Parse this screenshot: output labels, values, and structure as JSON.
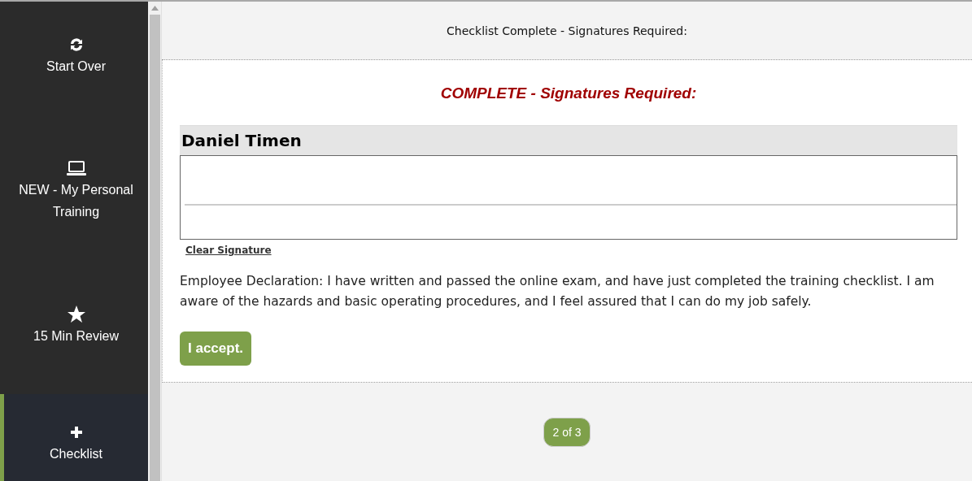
{
  "sidebar": {
    "items": [
      {
        "kind": "refresh",
        "label": "Start Over",
        "selected": false
      },
      {
        "kind": "laptop",
        "label": "NEW - My Personal Training",
        "selected": false
      },
      {
        "kind": "star",
        "label": "15 Min Review",
        "selected": false
      },
      {
        "kind": "plus",
        "label": "Checklist",
        "selected": true
      }
    ]
  },
  "header": {
    "title": "Checklist Complete - Signatures Required:"
  },
  "panel": {
    "status": "COMPLETE - Signatures Required:",
    "signer": "Daniel Timen",
    "clear_link": "Clear Signature",
    "declaration": "Employee Declaration: I have written and passed the online exam, and have just completed the training checklist. I am aware of the hazards and basic operating procedures, and I feel assured that I can do my job safely.",
    "accept_button": "I accept."
  },
  "pager": {
    "label": "2 of 3"
  }
}
